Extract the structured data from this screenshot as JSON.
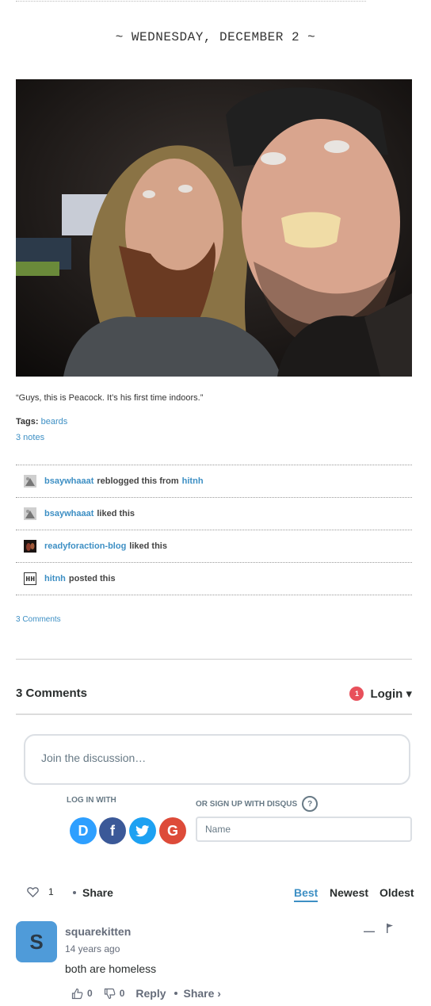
{
  "post": {
    "date": "~ WEDNESDAY, DECEMBER 2 ~",
    "caption": "“Guys, this is Peacock.  It’s his first time indoors.”",
    "tags_label": "Tags:",
    "tags": [
      "beards"
    ],
    "notes_count": "3 notes",
    "comments_link": "3 Comments"
  },
  "notes": [
    {
      "user": "bsaywhaaat",
      "action": "reblogged this from",
      "source": "hitnh",
      "avatar": "bsaywhaaat-avatar"
    },
    {
      "user": "bsaywhaaat",
      "action": "liked this",
      "source": "",
      "avatar": "bsaywhaaat-avatar"
    },
    {
      "user": "readyforaction-blog",
      "action": "liked this",
      "source": "",
      "avatar": "readyforaction-avatar"
    },
    {
      "user": "hitnh",
      "action": "posted this",
      "source": "",
      "avatar": "hitnh-avatar"
    }
  ],
  "disqus": {
    "count_label": "3 Comments",
    "login_badge": "1",
    "login_label": "Login ▾",
    "join_placeholder": "Join the discussion…",
    "login_with": "LOG IN WITH",
    "signup_with": "OR SIGN UP WITH DISQUS",
    "help_glyph": "?",
    "name_placeholder": "Name",
    "social": [
      {
        "name": "disqus",
        "glyph": "D",
        "color": "#2e9fff"
      },
      {
        "name": "facebook",
        "glyph": "f",
        "color": "#3b5998"
      },
      {
        "name": "twitter",
        "glyph": "t",
        "color": "#1da1f2"
      },
      {
        "name": "google",
        "glyph": "G",
        "color": "#dd4b39"
      }
    ],
    "recommend_count": "1",
    "share_label": "Share",
    "sort": {
      "best": "Best",
      "newest": "Newest",
      "oldest": "Oldest"
    }
  },
  "comment": {
    "avatar_letter": "S",
    "author": "squarekitten",
    "time": "14 years ago",
    "body": "both are homeless",
    "collapse": "—",
    "upvotes": "0",
    "downvotes": "0",
    "reply_label": "Reply",
    "share_label": "Share ›"
  },
  "colors": {
    "link": "#3d8fc4",
    "badge": "#e8505b",
    "comment_avatar": "#4f9bd9"
  }
}
